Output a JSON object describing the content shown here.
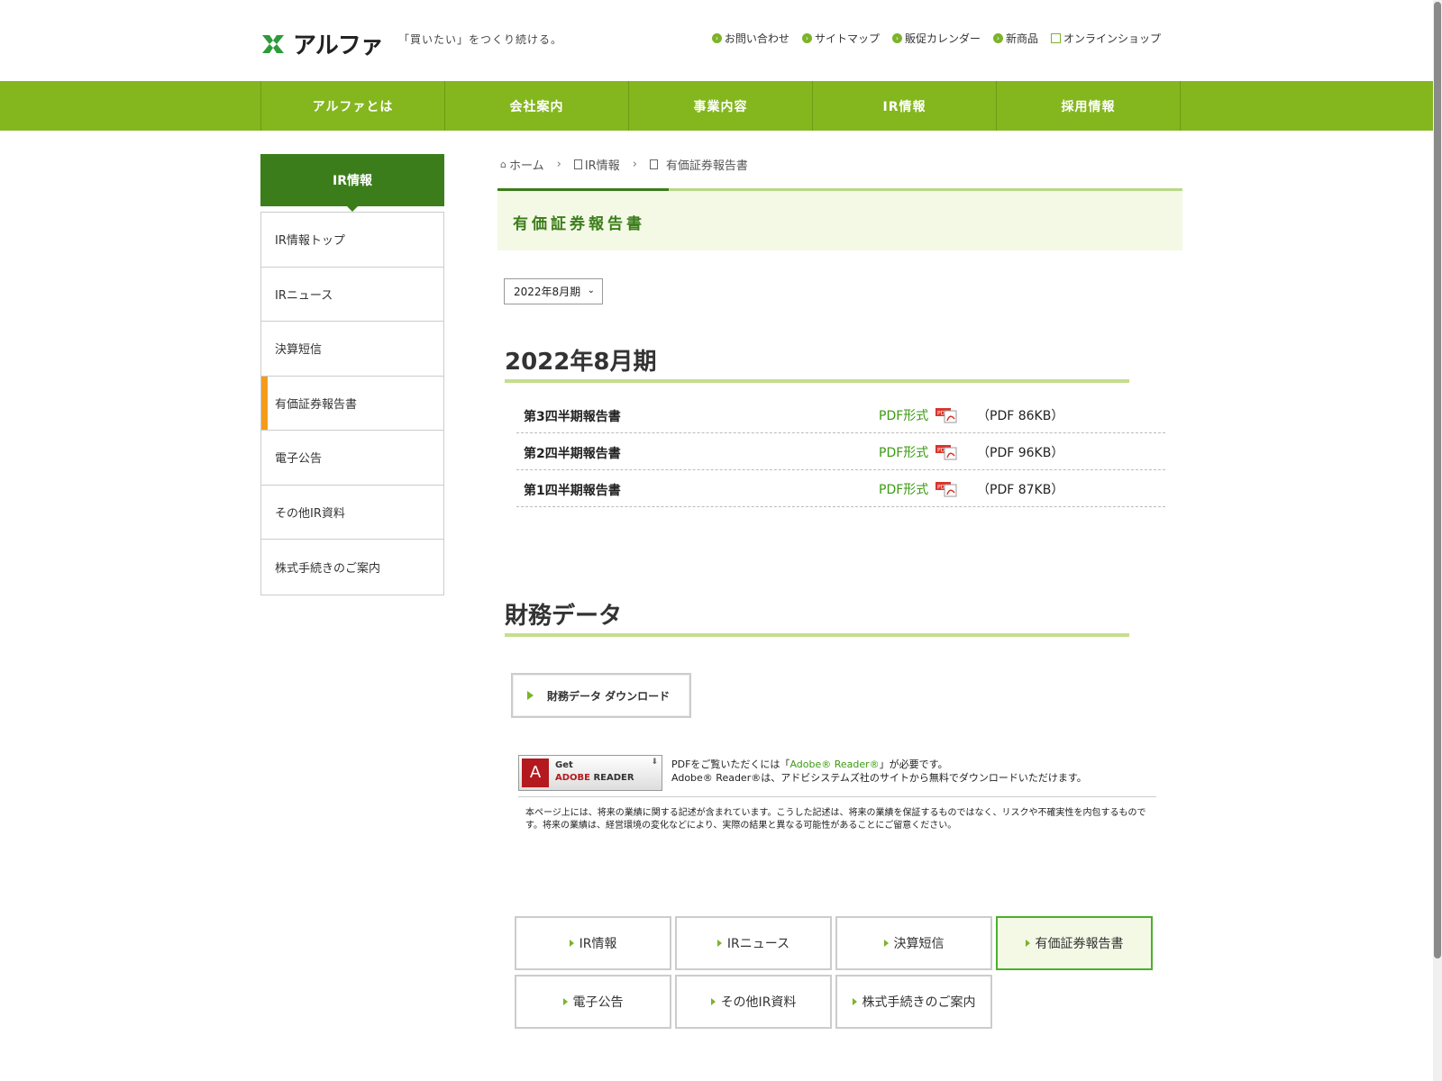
{
  "header": {
    "logo_text": "アルファ",
    "tagline": "「買いたい」をつくり続ける。",
    "top_links": [
      {
        "label": "お問い合わせ",
        "icon": "arrow-circle-icon"
      },
      {
        "label": "サイトマップ",
        "icon": "arrow-circle-icon"
      },
      {
        "label": "販促カレンダー",
        "icon": "arrow-circle-icon"
      },
      {
        "label": "新商品",
        "icon": "arrow-circle-icon"
      },
      {
        "label": "オンラインショップ",
        "icon": "external-link-icon"
      }
    ]
  },
  "gnav": {
    "items": [
      "アルファとは",
      "会社案内",
      "事業内容",
      "IR情報",
      "採用情報"
    ]
  },
  "sidebar": {
    "heading": "IR情報",
    "items": [
      "IR情報トップ",
      "IRニュース",
      "決算短信",
      "有価証券報告書",
      "電子公告",
      "その他IR資料",
      "株式手続きのご案内"
    ],
    "active_index": 3
  },
  "breadcrumb": {
    "home": "ホーム",
    "level1": "IR情報",
    "current": "有価証券報告書"
  },
  "page_title": "有価証券報告書",
  "year_select": {
    "value": "2022年8月期"
  },
  "report_section": {
    "heading": "2022年8月期",
    "rows": [
      {
        "name": "第3四半期報告書",
        "link": "PDF形式",
        "size": "（PDF 86KB）"
      },
      {
        "name": "第2四半期報告書",
        "link": "PDF形式",
        "size": "（PDF 96KB）"
      },
      {
        "name": "第1四半期報告書",
        "link": "PDF形式",
        "size": "（PDF 87KB）"
      }
    ]
  },
  "financial_section": {
    "heading": "財務データ",
    "button": "財務データ ダウンロード"
  },
  "adobe": {
    "get": "Get",
    "reader_brand": "ADOBE",
    "reader_word": "READER",
    "line1_pre": "PDFをご覧いただくには「",
    "line1_link": "Adobe® Reader®",
    "line1_post": "」が必要です。",
    "line2": "Adobe® Reader®は、アドビシステムズ社のサイトから無料でダウンロードいただけます。"
  },
  "disclaimer": "本ページ上には、将来の業績に関する記述が含まれています。こうした記述は、将来の業績を保証するものではなく、リスクや不確実性を内包するものです。将来の業績は、経営環境の変化などにより、実際の結果と異なる可能性があることにご留意ください。",
  "bottom_nav": {
    "items": [
      "IR情報",
      "IRニュース",
      "決算短信",
      "有価証券報告書",
      "電子公告",
      "その他IR資料",
      "株式手続きのご案内"
    ],
    "active_index": 3
  },
  "colors": {
    "brand_green": "#84b61e",
    "dark_green": "#3c7d1b",
    "link_green": "#3b9a12",
    "active_orange": "#f59b1a"
  }
}
